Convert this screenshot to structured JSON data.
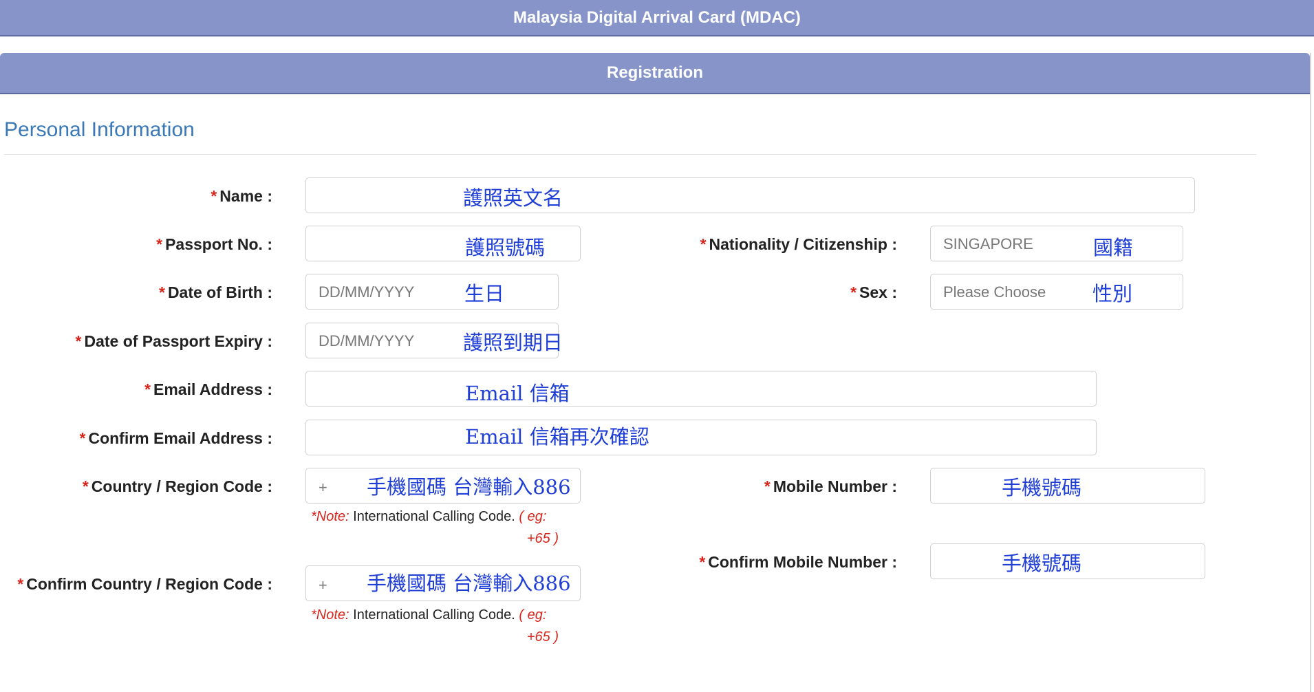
{
  "app_title": "Malaysia Digital Arrival Card (MDAC)",
  "panel_title": "Registration",
  "section_title": "Personal Information",
  "required_mark": "*",
  "fields": {
    "name": {
      "label": "Name :",
      "value": "",
      "annotation": "護照英文名"
    },
    "passport_no": {
      "label": "Passport No. :",
      "value": "",
      "annotation": "護照號碼"
    },
    "nationality": {
      "label": "Nationality / Citizenship :",
      "value": "SINGAPORE",
      "annotation": "國籍"
    },
    "dob": {
      "label": "Date of Birth :",
      "placeholder": "DD/MM/YYYY",
      "annotation": "生日"
    },
    "sex": {
      "label": "Sex :",
      "placeholder": "Please Choose",
      "annotation": "性別"
    },
    "passport_expiry": {
      "label": "Date of Passport Expiry :",
      "placeholder": "DD/MM/YYYY",
      "annotation": "護照到期日"
    },
    "email": {
      "label": "Email Address :",
      "value": "",
      "annotation": "Email 信箱"
    },
    "confirm_email": {
      "label": "Confirm Email Address :",
      "value": "",
      "annotation": "Email 信箱再次確認"
    },
    "country_code": {
      "label": "Country / Region Code :",
      "prefix": "+",
      "annotation": "手機國碼 台灣輸入886"
    },
    "mobile": {
      "label": "Mobile Number :",
      "value": "",
      "annotation": "手機號碼"
    },
    "confirm_mobile": {
      "label": "Confirm Mobile Number :",
      "value": "",
      "annotation": "手機號碼"
    },
    "confirm_country_code": {
      "label": "Confirm Country / Region Code :",
      "prefix": "+",
      "annotation": "手機國碼 台灣輸入886"
    }
  },
  "note": {
    "prefix": "*Note:",
    "text": " International Calling Code. ",
    "example_open": "( eg:",
    "example_value": "+65 )"
  },
  "colors": {
    "header_bg": "#8694c9",
    "section_title": "#3a78b8",
    "required": "#d9241b",
    "annotation": "#1f3ed6"
  }
}
